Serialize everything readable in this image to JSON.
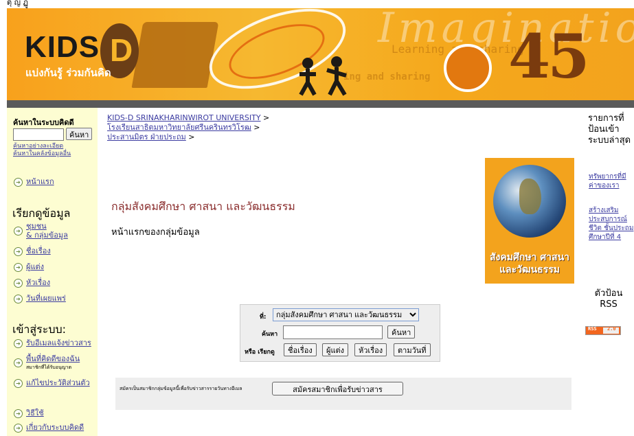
{
  "top_text": "ตุ         ญ                   ฏู",
  "banner": {
    "logo": "KIDS",
    "logo_letter": "D",
    "tagline": "แบ่งกันรู้ ร่วมกันคิด",
    "imagine": "Imagination",
    "learning_text": "Learning and sharing",
    "learning_text2": "ing and sharing",
    "number": "45",
    "figures": "ꏍꏍ"
  },
  "left": {
    "search_title": "ค้นหาในระบบคิดดี",
    "search_button": "ค้นหา",
    "adv_search": "ค้นหาอย่างละเอียด",
    "repo_search": "ค้นหาในคลังข้อมูลอื่น",
    "home": "หน้าแรก",
    "browse_title": "เรียกดูข้อมูล",
    "browse": {
      "community_1": "ชุมชน",
      "community_2": "& กลุ่มข้อมูล",
      "title": "ชื่อเรื่อง",
      "author": "ผู้แต่ง",
      "subject": "หัวเรื่อง",
      "date": "วันที่เผยแพร่"
    },
    "login_title": "เข้าสู่ระบบ:",
    "login": {
      "email": "รับอีเมลแจ้งข่าวสาร",
      "my_space": "พื้นที่คิดดีของฉัน",
      "my_space_note": "สมาชิกที่ได้รับอนุญาต",
      "profile": "แก้ไขประวัติส่วนตัว"
    },
    "help": "วิธีใช้",
    "about": "เกี่ยวกับระบบคิดดี"
  },
  "breadcrumb": {
    "level1": "KIDS-D SRINAKHARINWIROT UNIVERSITY",
    "level2": "โรงเรียนสาธิตมหาวิทยาลัยศรีนครินทรวิโรฒ",
    "level3": "ประสานมิตร ฝ่ายประถม",
    "sep": ">"
  },
  "main": {
    "title": "กลุ่มสังคมศึกษา ศาสนา และวัฒนธรรม",
    "subtitle": "หน้าแรกของกลุ่มข้อมูล",
    "poster_line1": "สังคมศึกษา ศาสนา",
    "poster_line2": "และวัฒนธรรม"
  },
  "search_form": {
    "in_label": "ที่:",
    "scope_value": "กลุ่มสังคมศึกษา ศาสนา และวัฒนธรรม",
    "search_label": "ค้นหา",
    "search_button": "ค้นหา",
    "browse_label": "หรือ เรียกดู",
    "btn_title": "ชื่อเรื่อง",
    "btn_author": "ผู้แต่ง",
    "btn_subject": "หัวเรื่อง",
    "btn_date": "ตามวันที่"
  },
  "subscribe": {
    "text": "สมัครเป็นสมาชิกกลุ่มข้อมูลนี้เพื่อรับข่าวสารรายวันทางอีเมล",
    "button": "สมัครสมาชิกเพื่อรับข่าวสาร"
  },
  "right": {
    "title": "รายการที่ป้อนเข้าระบบล่าสุด",
    "item1": "ทรัพยากรที่มีค่าของเรา",
    "item2": "สร้างเสริมประสบการณ์ชีวิต ชั้นประถมศึกษาปีที่ 4",
    "rss_title": "ตัวป้อน RSS",
    "rss_badge": "RSS",
    "rss_version": "2.0"
  }
}
